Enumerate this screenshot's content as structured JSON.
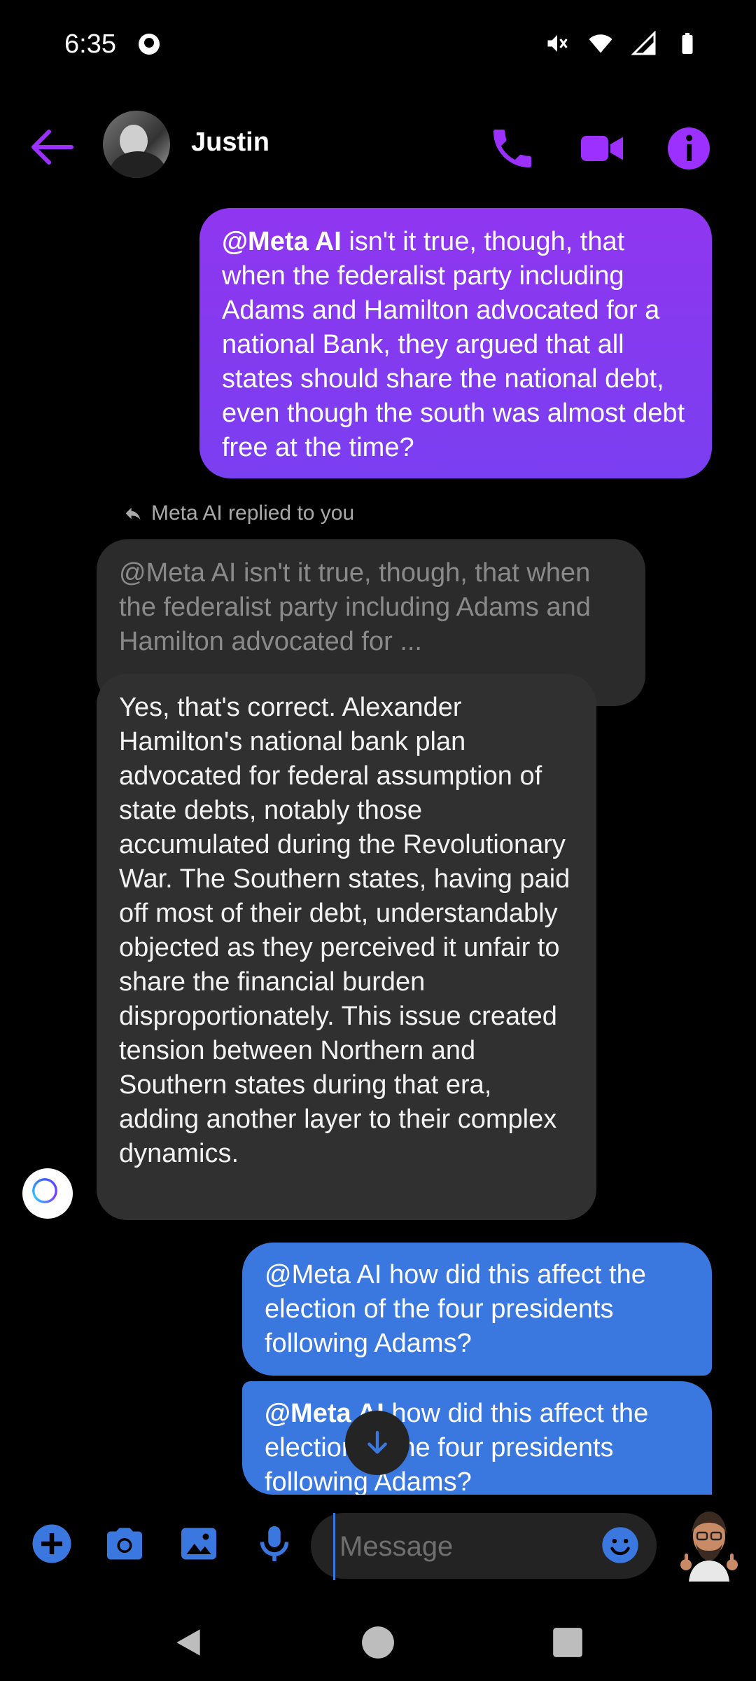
{
  "status_bar": {
    "time": "6:35"
  },
  "header": {
    "contact_name": "Justin"
  },
  "colors": {
    "accent_purple": "#9b30ff",
    "outgoing_blue": "#3a78e0",
    "bubble_gray": "#303030"
  },
  "messages": {
    "outgoing_1": {
      "mention": "@Meta AI",
      "text": " isn't it true, though, that when the federalist party including Adams and Hamilton advocated for a national Bank, they argued that all states should share the national debt, even though the south was almost debt free at the time?"
    },
    "reply_label": "Meta AI replied to you",
    "reply_quote": "@Meta AI isn't it true, though, that when the federalist party including Adams and Hamilton advocated for ...",
    "incoming_ai": "Yes, that's correct. Alexander Hamilton's national bank plan advocated for federal assumption of state debts, notably those accumulated during the Revolutionary War. The Southern states, having paid off most of their debt, understandably objected as they perceived it unfair to share the financial burden disproportionately. This issue created tension between Northern and Southern states during that era, adding another layer to their complex dynamics.",
    "outgoing_2": "@Meta AI how did this affect the election of the four presidents following Adams?",
    "outgoing_3": {
      "mention": "@Meta AI",
      "text": " how did this affect the election of the four presidents following Adams?"
    }
  },
  "composer": {
    "placeholder": "Message"
  }
}
